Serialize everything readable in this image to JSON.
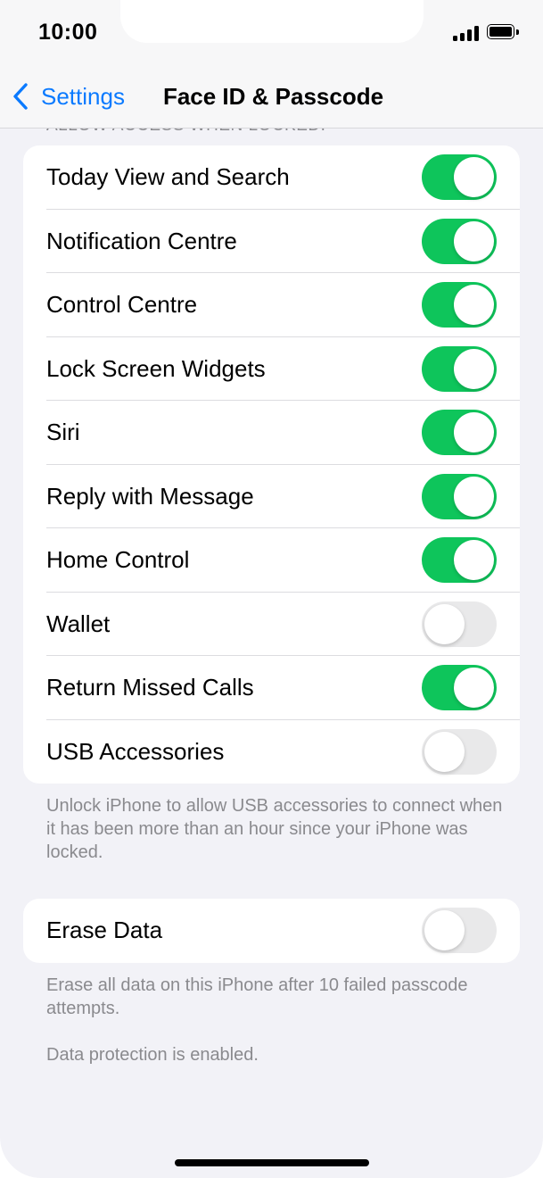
{
  "status_bar": {
    "time": "10:00"
  },
  "nav": {
    "back_label": "Settings",
    "title": "Face ID & Passcode"
  },
  "section_header_partial": "ALLOW ACCESS WHEN LOCKED:",
  "lock_access_items": [
    {
      "label": "Today View and Search",
      "on": true
    },
    {
      "label": "Notification Centre",
      "on": true
    },
    {
      "label": "Control Centre",
      "on": true
    },
    {
      "label": "Lock Screen Widgets",
      "on": true
    },
    {
      "label": "Siri",
      "on": true
    },
    {
      "label": "Reply with Message",
      "on": true
    },
    {
      "label": "Home Control",
      "on": true
    },
    {
      "label": "Wallet",
      "on": false
    },
    {
      "label": "Return Missed Calls",
      "on": true
    },
    {
      "label": "USB Accessories",
      "on": false
    }
  ],
  "usb_footnote": "Unlock iPhone to allow USB accessories to connect when it has been more than an hour since your iPhone was locked.",
  "erase": {
    "label": "Erase Data",
    "on": false
  },
  "erase_footnote": "Erase all data on this iPhone after 10 failed passcode attempts.",
  "protection_note": "Data protection is enabled.",
  "colors": {
    "toggle_on": "#0ec55b",
    "toggle_off": "#e9e9ea",
    "accent": "#0a7aff"
  }
}
